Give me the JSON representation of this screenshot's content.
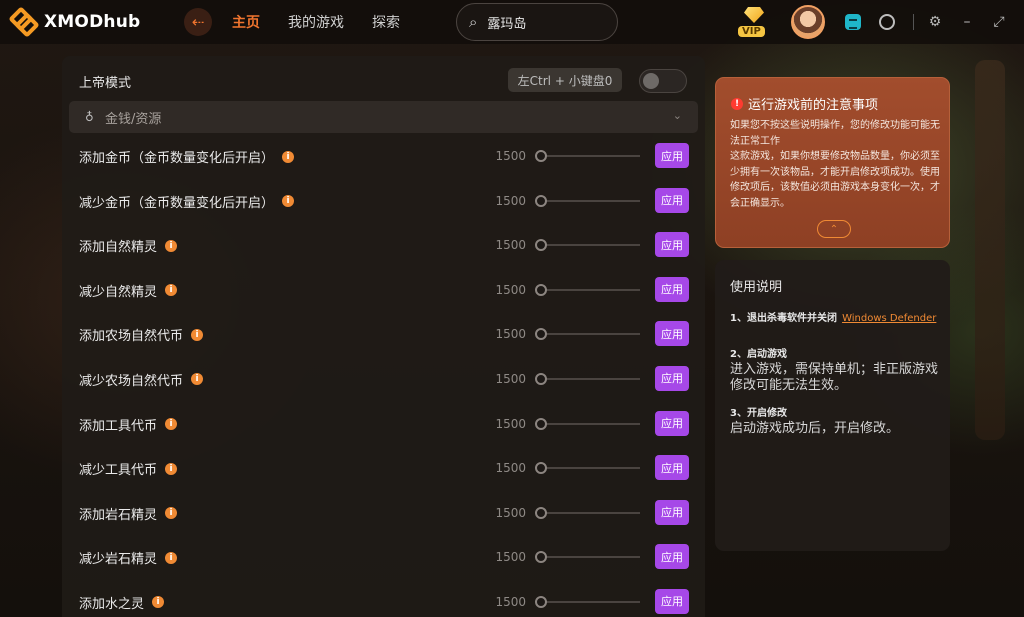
{
  "app": {
    "logo_text": "XMODhub",
    "nav": [
      "主页",
      "我的游戏",
      "探索"
    ],
    "search_value": "露玛岛",
    "vip_label": "VIP"
  },
  "panel": {
    "god_mode_label": "上帝模式",
    "god_mode_hotkey": "左Ctrl + 小键盘0",
    "section_title": "金钱/资源",
    "rows": [
      {
        "label": "添加金币（金币数量变化后开启）",
        "value": "1500",
        "button": "应用"
      },
      {
        "label": "减少金币（金币数量变化后开启）",
        "value": "1500",
        "button": "应用"
      },
      {
        "label": "添加自然精灵",
        "value": "1500",
        "button": "应用"
      },
      {
        "label": "减少自然精灵",
        "value": "1500",
        "button": "应用"
      },
      {
        "label": "添加农场自然代币",
        "value": "1500",
        "button": "应用"
      },
      {
        "label": "减少农场自然代币",
        "value": "1500",
        "button": "应用"
      },
      {
        "label": "添加工具代币",
        "value": "1500",
        "button": "应用"
      },
      {
        "label": "减少工具代币",
        "value": "1500",
        "button": "应用"
      },
      {
        "label": "添加岩石精灵",
        "value": "1500",
        "button": "应用"
      },
      {
        "label": "减少岩石精灵",
        "value": "1500",
        "button": "应用"
      },
      {
        "label": "添加水之灵",
        "value": "1500",
        "button": "应用"
      }
    ]
  },
  "notice": {
    "title": "运行游戏前的注意事项",
    "paragraphs": [
      "如果您不按这些说明操作，您的修改功能可能无法正常工作",
      "这款游戏，如果你想要修改物品数量，你必须至少拥有一次该物品，才能开启修改项成功。使用修改项后，该数值必须由游戏本身变化一次，才会正确显示。"
    ]
  },
  "usage": {
    "title": "使用说明",
    "step1_title": "1、退出杀毒软件并关闭",
    "step1_link": "Windows Defender",
    "step2_title": "2、启动游戏",
    "step2_text": "进入游戏，需保持单机；非正版游戏修改可能无法生效。",
    "step3_title": "3、开启修改",
    "step3_text": "启动游戏成功后，开启修改。"
  }
}
